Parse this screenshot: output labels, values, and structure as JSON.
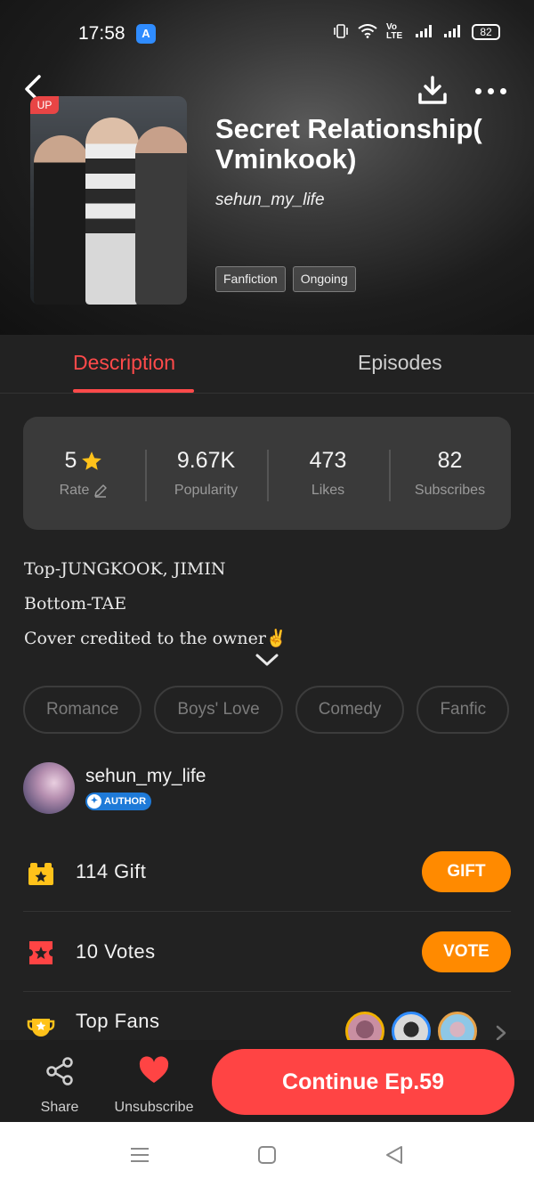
{
  "status_bar": {
    "time": "17:58",
    "network": "Vo LTE",
    "battery": "82"
  },
  "header": {
    "cover_badge": "UP",
    "title": "Secret Relationship( Vminkook)",
    "author": "sehun_my_life",
    "tags": [
      "Fanfiction",
      "Ongoing"
    ]
  },
  "tabs": {
    "description": "Description",
    "episodes": "Episodes"
  },
  "stats": {
    "rate_value": "5",
    "rate_label": "Rate",
    "popularity_value": "9.67K",
    "popularity_label": "Popularity",
    "likes_value": "473",
    "likes_label": "Likes",
    "subscribes_value": "82",
    "subscribes_label": "Subscribes"
  },
  "description": {
    "lines": [
      "Top-JUNGKOOK, JIMIN",
      "Bottom-TAE",
      "Cover credited to the owner✌"
    ]
  },
  "genres": [
    "Romance",
    "Boys' Love",
    "Comedy",
    "Fanfic"
  ],
  "author_section": {
    "name": "sehun_my_life",
    "badge": "AUTHOR"
  },
  "gift": {
    "label": "114 Gift",
    "button": "GIFT"
  },
  "vote": {
    "label": "10 Votes",
    "button": "VOTE"
  },
  "top_fans": {
    "label": "Top Fans"
  },
  "bottom_bar": {
    "share": "Share",
    "unsubscribe": "Unsubscribe",
    "continue": "Continue Ep.59"
  },
  "colors": {
    "accent_red": "#ff4444",
    "accent_orange": "#ff8a00",
    "background": "#222222",
    "star": "#ffc21a"
  },
  "icons": [
    "back-icon",
    "download-icon",
    "more-icon",
    "star-icon",
    "pencil-icon",
    "chevron-down-icon",
    "gift-icon",
    "vote-ticket-icon",
    "trophy-icon",
    "chevron-right-icon",
    "share-icon",
    "heart-icon"
  ]
}
